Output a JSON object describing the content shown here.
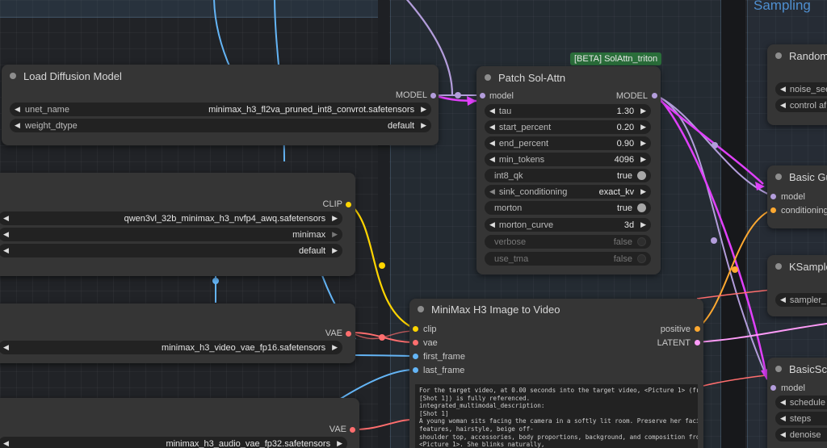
{
  "groups": {
    "sampling_title": "Sampling"
  },
  "nodes": {
    "load_diffusion": {
      "title": "Load Diffusion Model",
      "output": "MODEL",
      "widgets": [
        {
          "label": "unet_name",
          "value": "minimax_h3_fl2va_pruned_int8_convrot.safetensors"
        },
        {
          "label": "weight_dtype",
          "value": "default"
        }
      ]
    },
    "clip_loader": {
      "output": "CLIP",
      "widgets": [
        {
          "value": "qwen3vl_32b_minimax_h3_nvfp4_awq.safetensors"
        },
        {
          "value": "minimax"
        },
        {
          "value": "default"
        }
      ]
    },
    "vae_loader": {
      "output": "VAE",
      "widgets": [
        {
          "value": "minimax_h3_video_vae_fp16.safetensors"
        }
      ]
    },
    "audio_vae_loader": {
      "output": "VAE",
      "widgets": [
        {
          "value": "minimax_h3_audio_vae_fp32.safetensors"
        }
      ]
    },
    "patch_sol_attn": {
      "badge": "[BETA] SolAttn_triton",
      "title": "Patch Sol-Attn",
      "input": "model",
      "output": "MODEL",
      "widgets": [
        {
          "label": "tau",
          "value": "1.30",
          "kind": "number"
        },
        {
          "label": "start_percent",
          "value": "0.20",
          "kind": "number"
        },
        {
          "label": "end_percent",
          "value": "0.90",
          "kind": "number"
        },
        {
          "label": "min_tokens",
          "value": "4096",
          "kind": "number"
        },
        {
          "label": "int8_qk",
          "value": "true",
          "kind": "toggle-on"
        },
        {
          "label": "sink_conditioning",
          "value": "exact_kv",
          "kind": "combo"
        },
        {
          "label": "morton",
          "value": "true",
          "kind": "toggle-on"
        },
        {
          "label": "morton_curve",
          "value": "3d",
          "kind": "combo"
        },
        {
          "label": "verbose",
          "value": "false",
          "kind": "toggle-off"
        },
        {
          "label": "use_tma",
          "value": "false",
          "kind": "toggle-off"
        }
      ]
    },
    "image_to_video": {
      "title": "MiniMax H3 Image to Video",
      "inputs": [
        "clip",
        "vae",
        "first_frame",
        "last_frame"
      ],
      "outputs": [
        "positive",
        "LATENT"
      ],
      "prompt": "For the target video, at 0.00 seconds into the target video, <Picture 1> (from\n[Shot 1]) is fully referenced.\nintegrated_multimodal_description:\n[Shot 1]\nA young woman sits facing the camera in a softly lit room. Preserve her facial\nfeatures, hairstyle, beige off-\nshoulder top, accessories, body proportions, background, and composition from\n<Picture 1>. She blinks naturally,\nslightly tilts her head, and gives a gentle smile. A few strands of hair move"
    },
    "random_noise": {
      "title": "RandomN",
      "widgets": [
        {
          "label": "noise_see"
        },
        {
          "label": "control af"
        }
      ]
    },
    "basic_guider": {
      "title": "Basic Gu",
      "inputs": [
        "model",
        "conditioning"
      ]
    },
    "ksampler": {
      "title": "KSampler",
      "widgets": [
        {
          "label": "sampler_"
        }
      ]
    },
    "basic_scheduler": {
      "title": "BasicSch",
      "inputs": [
        "model"
      ],
      "widgets": [
        {
          "label": "schedule"
        },
        {
          "label": "steps"
        },
        {
          "label": "denoise"
        }
      ]
    }
  },
  "colors": {
    "model_wire": "#b39ddb",
    "clip_wire": "#ffd500",
    "vae_wire": "#ff6e6e",
    "image_wire": "#64b5f6",
    "latent_wire": "#ff9cf9",
    "highlight_wire": "#e040fb",
    "cond_wire": "#ffa931"
  }
}
